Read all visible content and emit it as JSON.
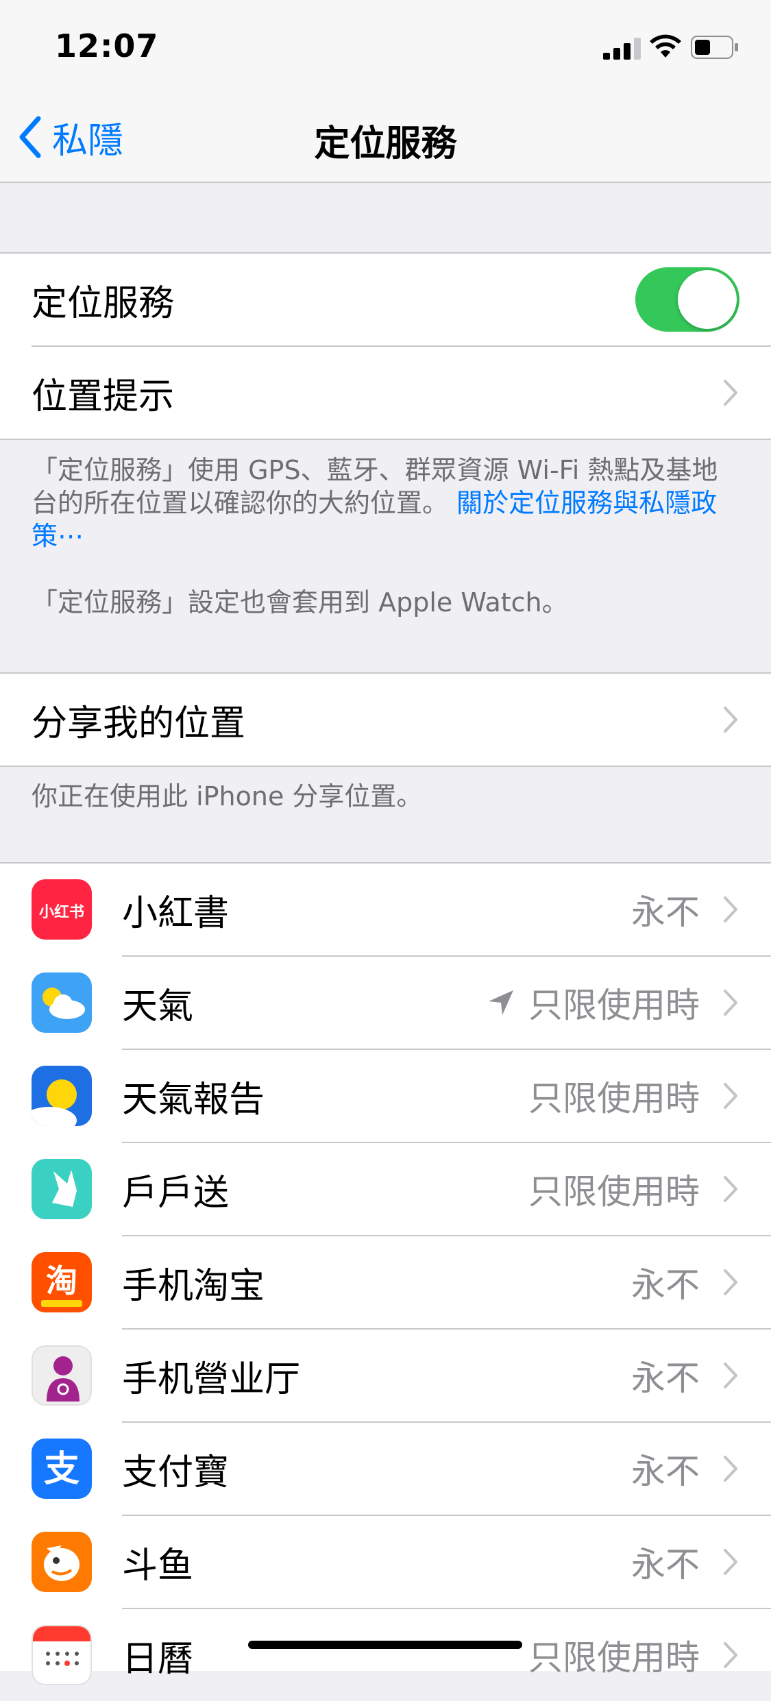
{
  "status": {
    "time": "12:07"
  },
  "nav": {
    "back_label": "私隱",
    "title": "定位服務"
  },
  "location_group": {
    "toggle_label": "定位服務",
    "toggle_on": true,
    "alerts_label": "位置提示"
  },
  "notes": {
    "description": "「定位服務」使用 GPS、藍牙、群眾資源 Wi-Fi 熱點及基地台的所在位置以確認你的大約位置。",
    "link": "關於定位服務與私隱政策⋯",
    "watch_note": "「定位服務」設定也會套用到 Apple Watch。",
    "share_note": "你正在使用此 iPhone 分享位置。"
  },
  "share": {
    "label": "分享我的位置"
  },
  "apps": [
    {
      "name": "小紅書",
      "value": "永不",
      "icon": "xiaohongshu-icon",
      "color": "#ff2442",
      "icon_text": "小红书"
    },
    {
      "name": "天氣",
      "value": "只限使用時",
      "icon": "weather-icon",
      "color": "#3ea2f5",
      "location_arrow": true
    },
    {
      "name": "天氣報告",
      "value": "只限使用時",
      "icon": "weather-report-icon",
      "color": "#1e6fe3"
    },
    {
      "name": "戶戶送",
      "value": "只限使用時",
      "icon": "deliveroo-icon",
      "color": "#3bd1c2"
    },
    {
      "name": "手机淘宝",
      "value": "永不",
      "icon": "taobao-icon",
      "color": "#ff5000",
      "icon_text": "淘"
    },
    {
      "name": "手机營业厅",
      "value": "永不",
      "icon": "unicom-icon",
      "color": "#eeeeee"
    },
    {
      "name": "支付寶",
      "value": "永不",
      "icon": "alipay-icon",
      "color": "#1677ff",
      "icon_text": "支"
    },
    {
      "name": "斗鱼",
      "value": "永不",
      "icon": "douyu-icon",
      "color": "#ff7a00"
    },
    {
      "name": "日曆",
      "value": "只限使用時",
      "icon": "calendar-icon",
      "color": "#ffffff"
    }
  ],
  "colors": {
    "accent": "#007aff",
    "toggle_on": "#34c759",
    "secondary_text": "#8e8e93"
  }
}
